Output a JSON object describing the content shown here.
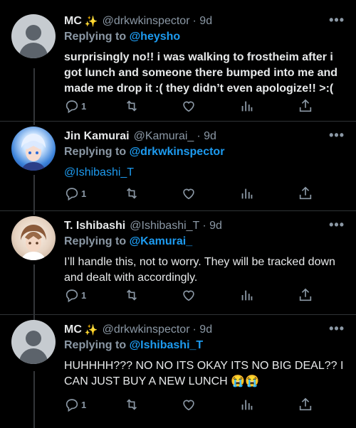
{
  "colors": {
    "background": "#000000",
    "accent": "#1d9bf0",
    "muted": "#8b98a5",
    "text": "#e7e9ea"
  },
  "tweets": [
    {
      "name": "MC",
      "badge": "✨",
      "handle": "@drkwkinspector",
      "time": "· 9d",
      "replying_label": "Replying to",
      "replying_to": "@heysho",
      "text": "surprisingly no!! i was walking to frostheim after i got lunch and someone there bumped into me and made me drop it :( they didn’t even apologize!! >:(",
      "reply_count": "1",
      "avatar": "default-avatar"
    },
    {
      "name": "Jin Kamurai",
      "handle": "@Kamurai_",
      "time": "· 9d",
      "replying_label": "Replying to",
      "replying_to": "@drkwkinspector",
      "text": "@Ishibashi_T",
      "reply_count": "1",
      "avatar": "anime-avatar-blue"
    },
    {
      "name": "T. Ishibashi",
      "handle": "@Ishibashi_T",
      "time": "· 9d",
      "replying_label": "Replying to",
      "replying_to": "@Kamurai_",
      "text": "I’ll handle this, not to worry. They will be tracked down and dealt with accordingly.",
      "reply_count": "1",
      "avatar": "anime-avatar-brown"
    },
    {
      "name": "MC",
      "badge": "✨",
      "handle": "@drkwkinspector",
      "time": "· 9d",
      "replying_label": "Replying to",
      "replying_to": "@Ishibashi_T",
      "text": "HUHHHH??? NO NO ITS OKAY ITS NO BIG DEAL?? I CAN JUST BUY A NEW LUNCH",
      "emoji": "😭😭",
      "reply_count": "1",
      "avatar": "default-avatar"
    }
  ],
  "more_label": "•••"
}
